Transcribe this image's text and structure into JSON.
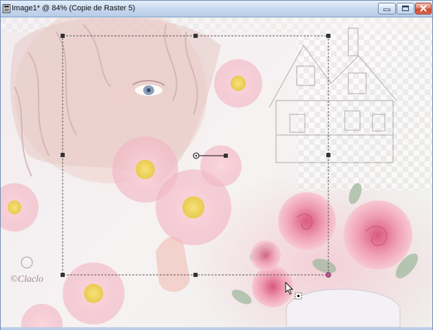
{
  "window": {
    "title": "Image1* @  84% (Copie de Raster 5)"
  },
  "controls": {
    "minimize_icon": "minimize-icon",
    "maximize_icon": "maximize-icon",
    "close_icon": "close-icon"
  },
  "canvas": {
    "watermark": "©Claclo",
    "image_subject": "woman with roses and house",
    "selection_tool": "pick/deform tool"
  }
}
